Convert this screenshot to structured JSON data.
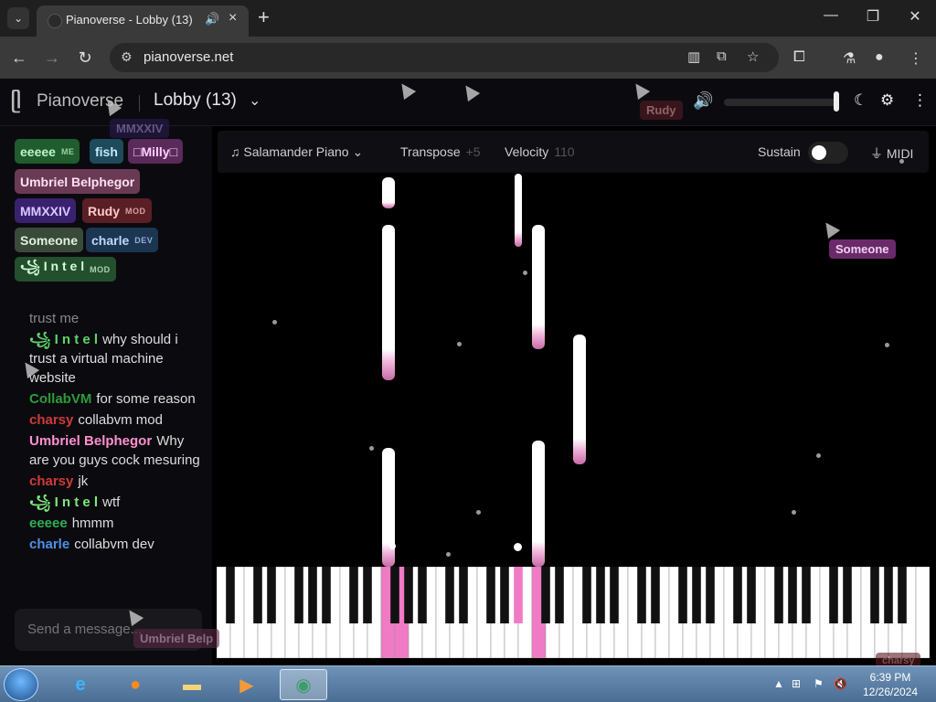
{
  "browser": {
    "tab_title": "Pianoverse - Lobby (13)",
    "url": "pianoverse.net",
    "new_tab": "+",
    "minimize": "—",
    "restore": "❐",
    "close": "✕"
  },
  "app": {
    "name": "Pianoverse",
    "room": "Lobby (13)"
  },
  "users": [
    {
      "name": "eeeee",
      "tag": "ME",
      "color": "#1f5c2e",
      "text": "#bff5c9"
    },
    {
      "name": "fish",
      "tag": "",
      "color": "#1f4a5c",
      "text": "#bfeaff"
    },
    {
      "name": "□Milly□",
      "tag": "",
      "color": "#5a2a5a",
      "text": "#ffd0ff"
    },
    {
      "name": "Umbriel Belphegor",
      "tag": "",
      "color": "#6a3a55",
      "text": "#ffe0ef"
    },
    {
      "name": "MMXXIV",
      "tag": "",
      "color": "#3a2170",
      "text": "#d8c8ff"
    },
    {
      "name": "Rudy",
      "tag": "MOD",
      "color": "#5a1f25",
      "text": "#ffc8c8"
    },
    {
      "name": "Someone",
      "tag": "",
      "color": "#3a4a3a",
      "text": "#e0f0e0"
    },
    {
      "name": "charle",
      "tag": "DEV",
      "color": "#1c3550",
      "text": "#bcd8ff"
    },
    {
      "name": "꧁ I n t e l",
      "tag": "MOD",
      "color": "#234f2d",
      "text": "#d0ffd8"
    }
  ],
  "chat": [
    {
      "name": "",
      "text": "trust me",
      "color": "#888"
    },
    {
      "name": "꧁ I n t e l",
      "text": "why should i trust a virtual machine website",
      "color": "#5fd36a"
    },
    {
      "name": "CollabVM",
      "text": "for some reason",
      "color": "#2e9b3a"
    },
    {
      "name": "charsy",
      "text": "collabvm mod",
      "color": "#d03a3a"
    },
    {
      "name": "Umbriel Belphegor",
      "text": "Why are you guys cock mesuring",
      "color": "#ff8fd0"
    },
    {
      "name": "charsy",
      "text": "jk",
      "color": "#d03a3a"
    },
    {
      "name": "꧁ I n t e l",
      "text": "wtf",
      "color": "#7ee87e"
    },
    {
      "name": "eeeee",
      "text": "hmmm",
      "color": "#2fae5a"
    },
    {
      "name": "charle",
      "text": "collabvm dev",
      "color": "#4e8fe8"
    }
  ],
  "send_placeholder": "Send a message...",
  "toolbar": {
    "instrument": "Salamander Piano",
    "transpose_label": "Transpose",
    "transpose_value": "+5",
    "velocity_label": "Velocity",
    "velocity_value": "110",
    "sustain_label": "Sustain",
    "midi_label": "MIDI"
  },
  "floating_tags": [
    {
      "name": "Someone",
      "color": "#6a2a6a"
    },
    {
      "name": "Rudy",
      "color": "#4a1a22"
    },
    {
      "name": "MMXXIV",
      "color": "#2a1a50"
    },
    {
      "name": "Umbriel Belp",
      "color": "#5a2a45"
    },
    {
      "name": "charsy",
      "color": "#5a1a20"
    }
  ],
  "taskbar": {
    "time": "6:39 PM",
    "date": "12/26/2024"
  }
}
